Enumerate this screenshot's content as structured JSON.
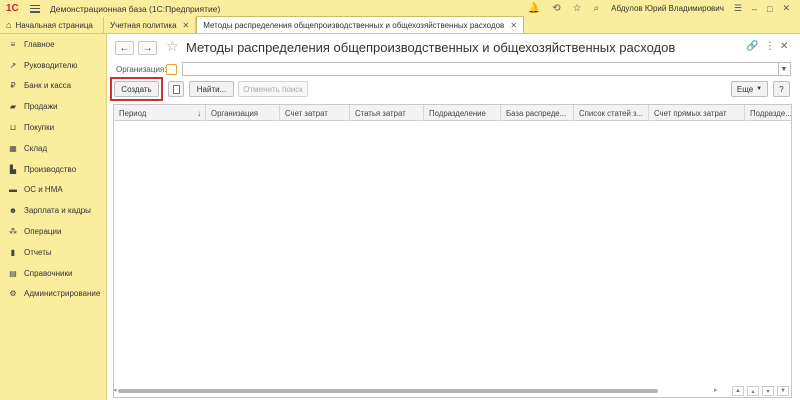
{
  "titlebar": {
    "logo": "1С",
    "title": "Демонстрационная база  (1С:Предприятие)",
    "user": "Абдулов Юрий Владимирович"
  },
  "tabs": {
    "home": "Начальная страница",
    "items": [
      {
        "label": "Учетная политика"
      },
      {
        "label": "Методы распределения общепроизводственных и общехозяйственных расходов"
      }
    ]
  },
  "sidebar": {
    "items": [
      {
        "label": "Главное",
        "icon": "menu-icon"
      },
      {
        "label": "Руководителю",
        "icon": "trend-icon"
      },
      {
        "label": "Банк и касса",
        "icon": "bank-icon"
      },
      {
        "label": "Продажи",
        "icon": "sales-icon"
      },
      {
        "label": "Покупки",
        "icon": "cart-icon"
      },
      {
        "label": "Склад",
        "icon": "warehouse-icon"
      },
      {
        "label": "Производство",
        "icon": "factory-icon"
      },
      {
        "label": "ОС и НМА",
        "icon": "truck-icon"
      },
      {
        "label": "Зарплата и кадры",
        "icon": "people-icon"
      },
      {
        "label": "Операции",
        "icon": "operations-icon"
      },
      {
        "label": "Отчеты",
        "icon": "reports-icon"
      },
      {
        "label": "Справочники",
        "icon": "book-icon"
      },
      {
        "label": "Администрирование",
        "icon": "gear-icon"
      }
    ]
  },
  "page": {
    "title": "Методы распределения общепроизводственных и общехозяйственных расходов"
  },
  "filter": {
    "org_label": "Организация:",
    "org_value": ""
  },
  "toolbar": {
    "create": "Создать",
    "find": "Найти...",
    "cancel_search": "Отменить поиск",
    "more": "Еще",
    "help": "?"
  },
  "table": {
    "columns": [
      "Период",
      "Организация",
      "Счет затрат",
      "Статья затрат",
      "Подразделение",
      "База распреде...",
      "Список статей з...",
      "Счет прямых затрат",
      "Подразде..."
    ]
  },
  "colors": {
    "panel": "#fbed9e",
    "highlight": "#d32f2f",
    "logo": "#d2232a"
  }
}
